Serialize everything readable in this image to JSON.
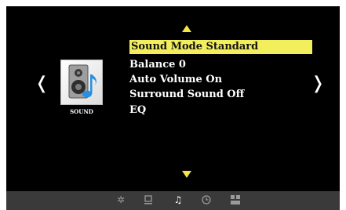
{
  "sidebar": {
    "caption": "SOUND",
    "icon": "speaker-music-note-icon"
  },
  "menu": {
    "items": [
      {
        "label": "Sound  Mode  Standard",
        "selected": true
      },
      {
        "label": "Balance  0",
        "selected": false
      },
      {
        "label": "Auto Volume On",
        "selected": false
      },
      {
        "label": "Surround Sound  Off",
        "selected": false
      },
      {
        "label": "EQ",
        "selected": false
      }
    ]
  },
  "nav": {
    "prev_glyph": "❬",
    "next_glyph": "❭"
  },
  "bottom_bar": {
    "icons": [
      "picture-settings-icon",
      "display-icon",
      "sound-icon",
      "clock-icon",
      "tiles-icon"
    ],
    "active": "sound-icon"
  },
  "colors": {
    "background": "#000000",
    "highlight": "#f3ee5b",
    "arrow": "#f2e64a",
    "bar": "#3a3a3a"
  }
}
